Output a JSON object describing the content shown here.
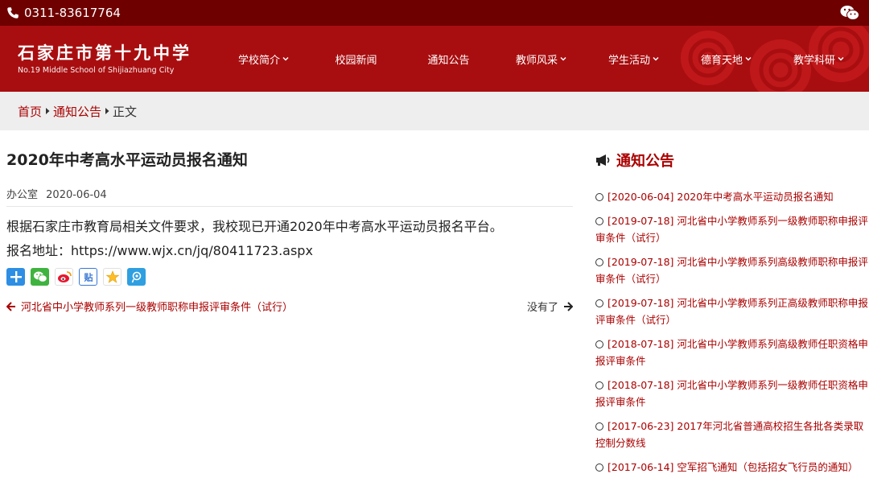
{
  "topbar": {
    "phone": "0311-83617764",
    "phone_icon": "phone-icon",
    "wechat_icon": "wechat-icon"
  },
  "header": {
    "logo_cn": "石家庄市第十九中学",
    "logo_en": "No.19 Middle School of Shijiazhuang City",
    "nav": [
      {
        "label": "学校简介",
        "has_dropdown": true
      },
      {
        "label": "校园新闻",
        "has_dropdown": false
      },
      {
        "label": "通知公告",
        "has_dropdown": false
      },
      {
        "label": "教师风采",
        "has_dropdown": true
      },
      {
        "label": "学生活动",
        "has_dropdown": true
      },
      {
        "label": "德育天地",
        "has_dropdown": true
      },
      {
        "label": "教学科研",
        "has_dropdown": true
      }
    ]
  },
  "breadcrumb": {
    "home": "首页",
    "section": "通知公告",
    "current": "正文"
  },
  "article": {
    "title": "2020年中考高水平运动员报名通知",
    "author": "办公室",
    "date": "2020-06-04",
    "paragraphs": [
      "根据石家庄市教育局相关文件要求，我校现已开通2020年中考高水平运动员报名平台。",
      "报名地址：https://www.wjx.cn/jq/80411723.aspx"
    ],
    "share_icons": [
      "plus-share-icon",
      "wechat-share-icon",
      "weibo-share-icon",
      "tieba-share-icon",
      "qzone-share-icon",
      "tencent-weibo-share-icon"
    ],
    "prev_label": "河北省中小学教师系列一级教师职称申报评审条件（试行）",
    "next_label": "没有了"
  },
  "sidebar": {
    "title": "通知公告",
    "items": [
      {
        "date": "[2020-06-04]",
        "text": "2020年中考高水平运动员报名通知"
      },
      {
        "date": "[2019-07-18]",
        "text": "河北省中小学教师系列一级教师职称申报评审条件（试行）"
      },
      {
        "date": "[2019-07-18]",
        "text": "河北省中小学教师系列高级教师职称申报评审条件（试行）"
      },
      {
        "date": "[2019-07-18]",
        "text": "河北省中小学教师系列正高级教师职称申报评审条件（试行）"
      },
      {
        "date": "[2018-07-18]",
        "text": "河北省中小学教师系列高级教师任职资格申报评审条件"
      },
      {
        "date": "[2018-07-18]",
        "text": "河北省中小学教师系列一级教师任职资格申报评审条件"
      },
      {
        "date": "[2017-06-23]",
        "text": "2017年河北省普通高校招生各批各类录取控制分数线"
      },
      {
        "date": "[2017-06-14]",
        "text": "空军招飞通知（包括招女飞行员的通知）"
      }
    ]
  },
  "colors": {
    "brand_red": "#a80e10",
    "topbar_dark": "#6f0000",
    "link_red": "#aa0000"
  }
}
